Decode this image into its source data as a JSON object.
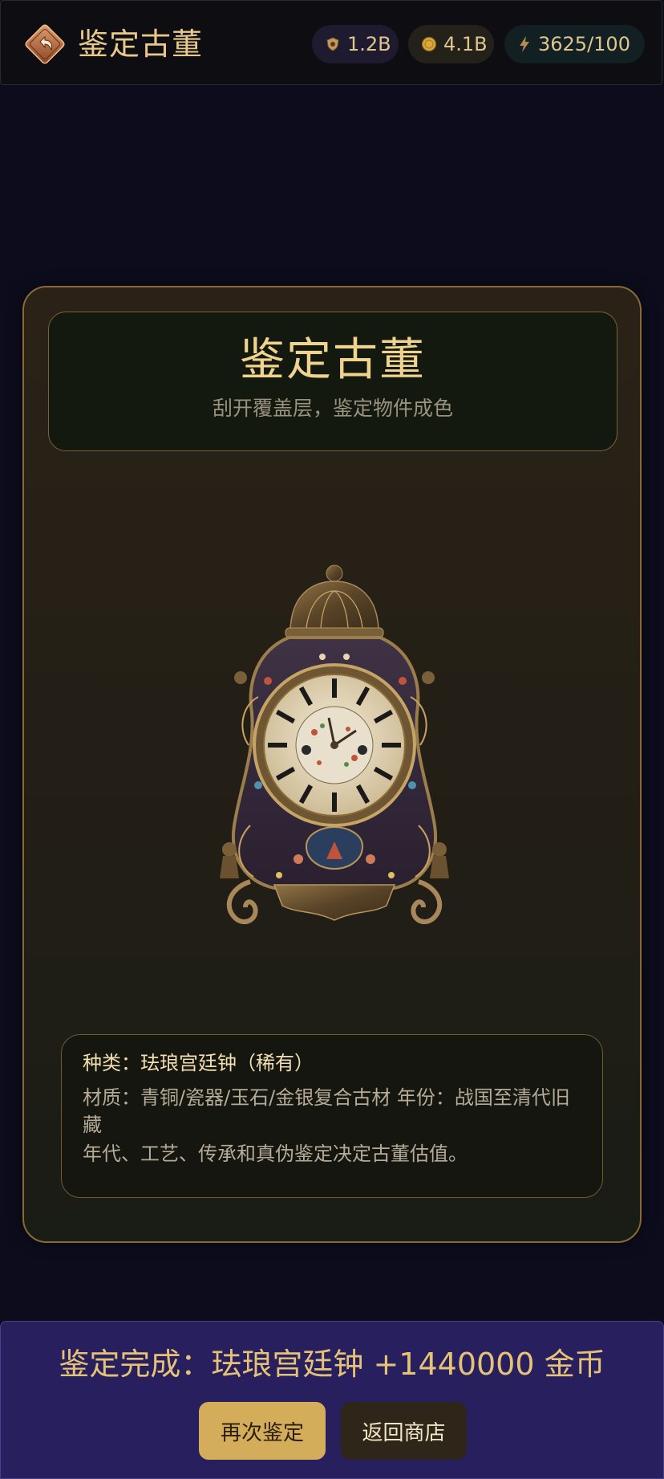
{
  "header": {
    "title": "鉴定古董",
    "back_icon": "back-arrow-icon",
    "currencies": [
      {
        "icon": "gem-shield-icon",
        "value": "1.2B"
      },
      {
        "icon": "coin-icon",
        "value": "4.1B"
      },
      {
        "icon": "lightning-icon",
        "value": "3625/100"
      }
    ]
  },
  "card": {
    "title": "鉴定古董",
    "subtitle": "刮开覆盖层，鉴定物件成色",
    "artifact_icon": "antique-clock-icon",
    "info": {
      "category": "种类：珐琅宫廷钟（稀有）",
      "material": "材质：青铜/瓷器/玉石/金银复合古材  年份：战国至清代旧藏",
      "description": "年代、工艺、传承和真伪鉴定决定古董估值。"
    }
  },
  "result": {
    "text": "鉴定完成：珐琅宫廷钟  +1440000 金币",
    "again_label": "再次鉴定",
    "shop_label": "返回商店"
  },
  "colors": {
    "accent_gold": "#e8c98a",
    "result_bg": "#271f5e",
    "primary_button": "#d4ad5a"
  }
}
